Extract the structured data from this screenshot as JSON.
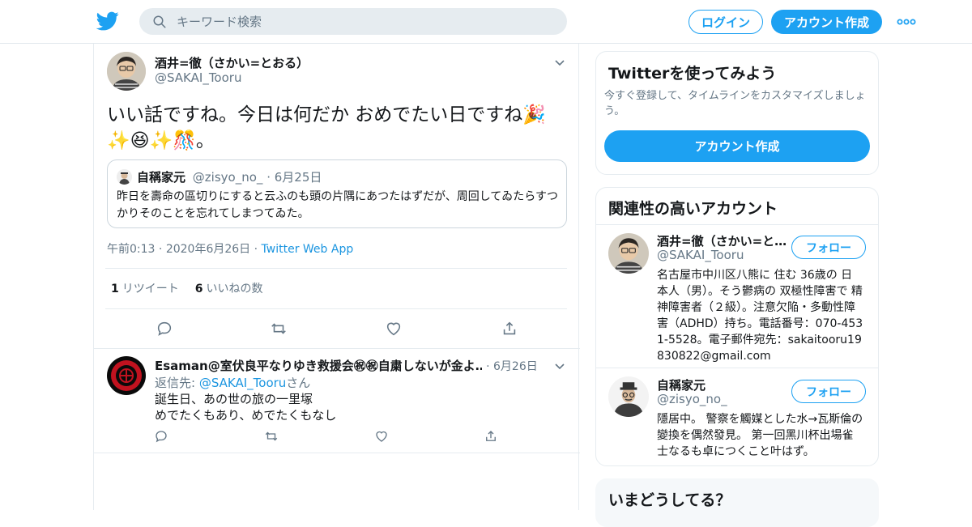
{
  "topbar": {
    "search_placeholder": "キーワード検索",
    "login_label": "ログイン",
    "signup_label": "アカウント作成"
  },
  "tweet": {
    "author_name": "酒井=徹（さかい=とおる）",
    "author_handle": "@SAKAI_Tooru",
    "text_line1": "いい話ですね。今日は何だか おめでたい日ですね🎉",
    "text_line2": "✨😆✨🎊。",
    "quote": {
      "author_name": "自稱家元",
      "author_handle": "@zisyo_no_",
      "date": "6月25日",
      "text": "昨日を壽命の區切りにすると云ふのも頭の片隅にあつたはずだが、周回してゐたらすつかりそのことを忘れてしまつてゐた。"
    },
    "time": "午前0:13",
    "date": "2020年6月26日",
    "app": "Twitter Web App",
    "retweet_count": "1",
    "retweet_label": "リツイート",
    "like_count": "6",
    "like_label": "いいねの数"
  },
  "reply": {
    "author_name": "Esaman@室伏良平なりゆき救援会㊗㊗自粛しないが金よ…",
    "date": "6月26日",
    "reply_prefix": "返信先: ",
    "reply_to": "@SAKAI_Tooru",
    "reply_suffix": "さん",
    "text_line1": "誕生日、あの世の旅の一里塚",
    "text_line2": "めでたくもあり、めでたくもなし"
  },
  "sidebar": {
    "signup_card": {
      "title": "Twitterを使ってみよう",
      "subtitle": "今すぐ登録して、タイムラインをカスタマイズしましょう。",
      "button": "アカウント作成"
    },
    "related": {
      "title": "関連性の高いアカウント",
      "follow_label": "フォロー",
      "accounts": [
        {
          "name": "酒井=徹（さかい=と…",
          "handle": "@SAKAI_Tooru",
          "bio": "名古屋市中川区八熊に 住む 36歳の 日本人（男）。そう鬱病の 双極性障害で 精神障害者（２級）。注意欠陥・多動性障害（ADHD）持ち。電話番号：070-4531-5528。電子郵件宛先：sakaitooru19830822@gmail.com"
        },
        {
          "name": "自稱家元",
          "handle": "@zisyo_no_",
          "bio": "隱居中。 警察を觸媒とした水→瓦斯倫の變換を偶然發見。 第一回黑川杯出場雀士なるも卓につくこと叶はず。"
        }
      ]
    },
    "trends": {
      "title": "いまどうしてる？"
    }
  },
  "colors": {
    "accent": "#1da1f2",
    "text": "#14171a",
    "muted": "#657786",
    "border": "#e6ecf0"
  }
}
